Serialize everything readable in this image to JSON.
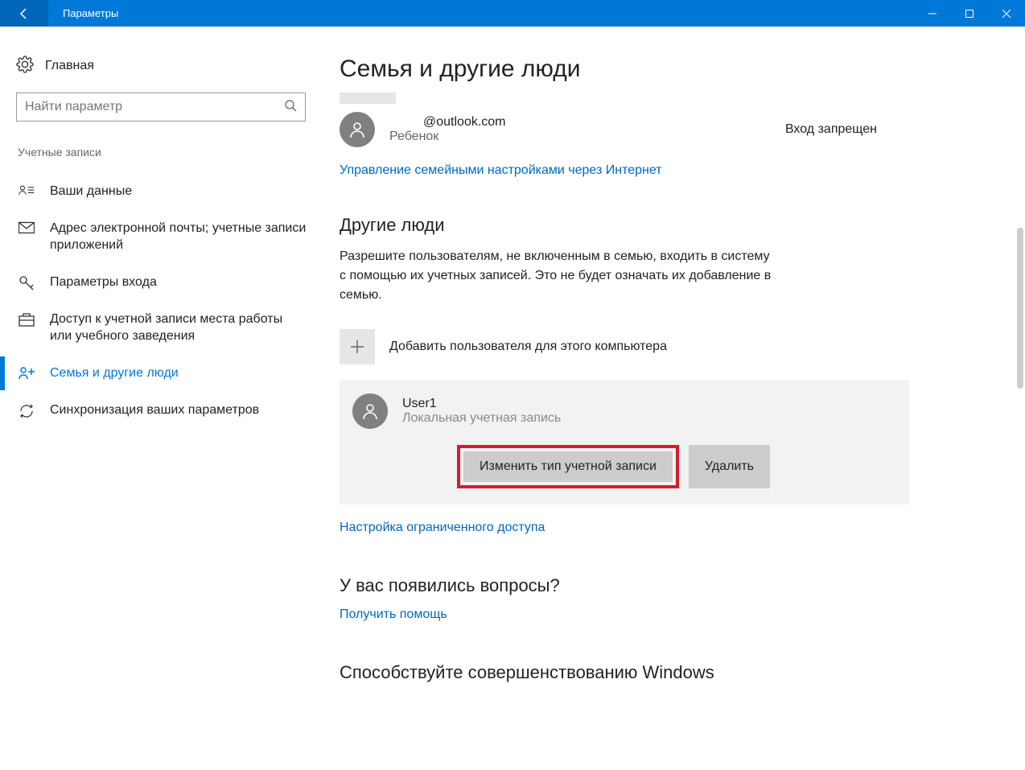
{
  "window": {
    "title": "Параметры"
  },
  "sidebar": {
    "home_label": "Главная",
    "search_placeholder": "Найти параметр",
    "group_title": "Учетные записи",
    "items": [
      {
        "label": "Ваши данные"
      },
      {
        "label": "Адрес электронной почты; учетные записи приложений"
      },
      {
        "label": "Параметры входа"
      },
      {
        "label": "Доступ к учетной записи места работы или учебного заведения"
      },
      {
        "label": "Семья и другие люди"
      },
      {
        "label": "Синхронизация ваших параметров"
      }
    ]
  },
  "main": {
    "page_title": "Семья и другие люди",
    "family_member": {
      "email": "@outlook.com",
      "role": "Ребенок",
      "status": "Вход запрещен"
    },
    "manage_link": "Управление семейными настройками через Интернет",
    "other_title": "Другие люди",
    "other_desc": "Разрешите пользователям, не включенным в семью, входить в систему с помощью их учетных записей. Это не будет означать их добавление в семью.",
    "add_user_label": "Добавить пользователя для этого компьютера",
    "user": {
      "name": "User1",
      "type": "Локальная учетная запись"
    },
    "change_type_btn": "Изменить тип учетной записи",
    "delete_btn": "Удалить",
    "restricted_link": "Настройка ограниченного доступа",
    "questions_title": "У вас появились вопросы?",
    "help_link": "Получить помощь",
    "improve_title": "Способствуйте совершенствованию Windows"
  }
}
